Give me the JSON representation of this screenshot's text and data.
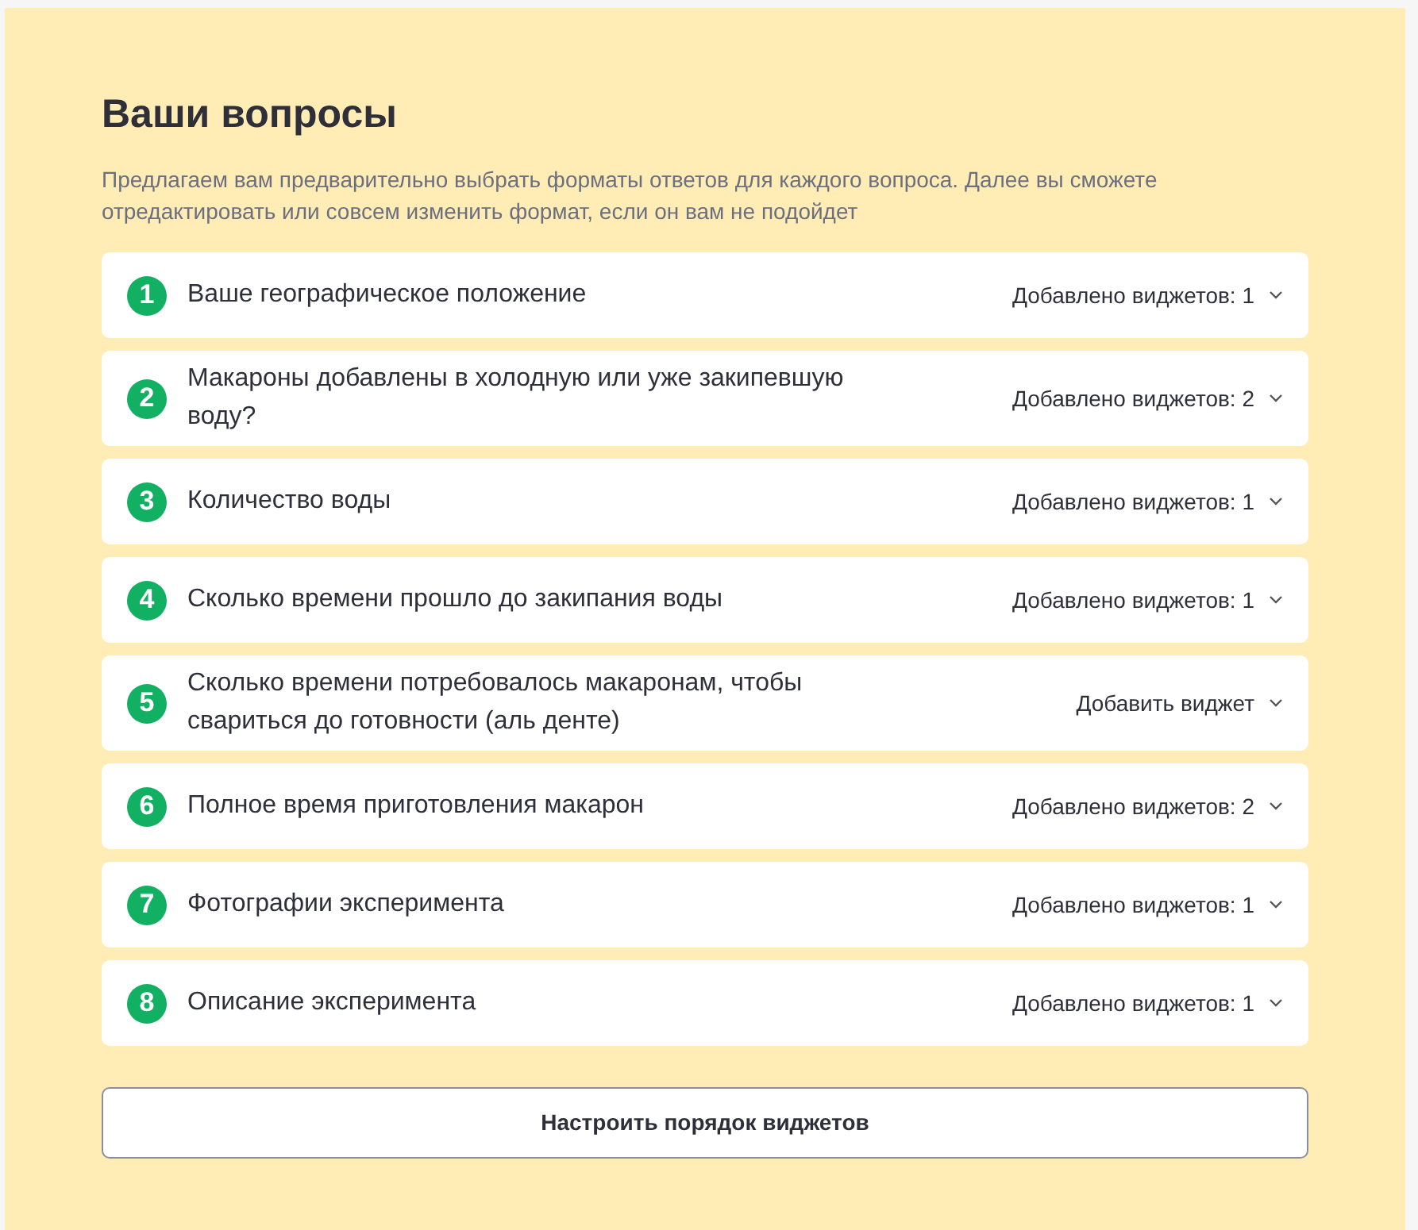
{
  "title": "Ваши вопросы",
  "description": "Предлагаем вам предварительно выбрать форматы ответов для каждого вопроса. Далее вы сможете отредактировать или совсем изменить формат, если он вам не подойдет",
  "questions": [
    {
      "number": "1",
      "text": "Ваше географическое положение",
      "status": "Добавлено виджетов: 1",
      "expanded": false
    },
    {
      "number": "2",
      "text": "Макароны добавлены в холодную или уже закипевшую воду?",
      "status": "Добавлено виджетов: 2",
      "expanded": false
    },
    {
      "number": "3",
      "text": "Количество воды",
      "status": "Добавлено виджетов: 1",
      "expanded": false
    },
    {
      "number": "4",
      "text": "Сколько времени прошло до закипания воды",
      "status": "Добавлено виджетов: 1",
      "expanded": false
    },
    {
      "number": "5",
      "text": "Сколько времени потребовалось макаронам, чтобы свариться до готовности (аль денте)",
      "status": "Добавить виджет",
      "expanded": false
    },
    {
      "number": "6",
      "text": "Полное время приготовления макарон",
      "status": "Добавлено виджетов: 2",
      "expanded": false
    },
    {
      "number": "7",
      "text": "Фотографии эксперимента",
      "status": "Добавлено виджетов: 1",
      "expanded": false
    },
    {
      "number": "8",
      "text": "Описание эксперимента",
      "status": "Добавлено виджетов: 1",
      "expanded": false
    }
  ],
  "button": "Настроить порядок виджетов"
}
